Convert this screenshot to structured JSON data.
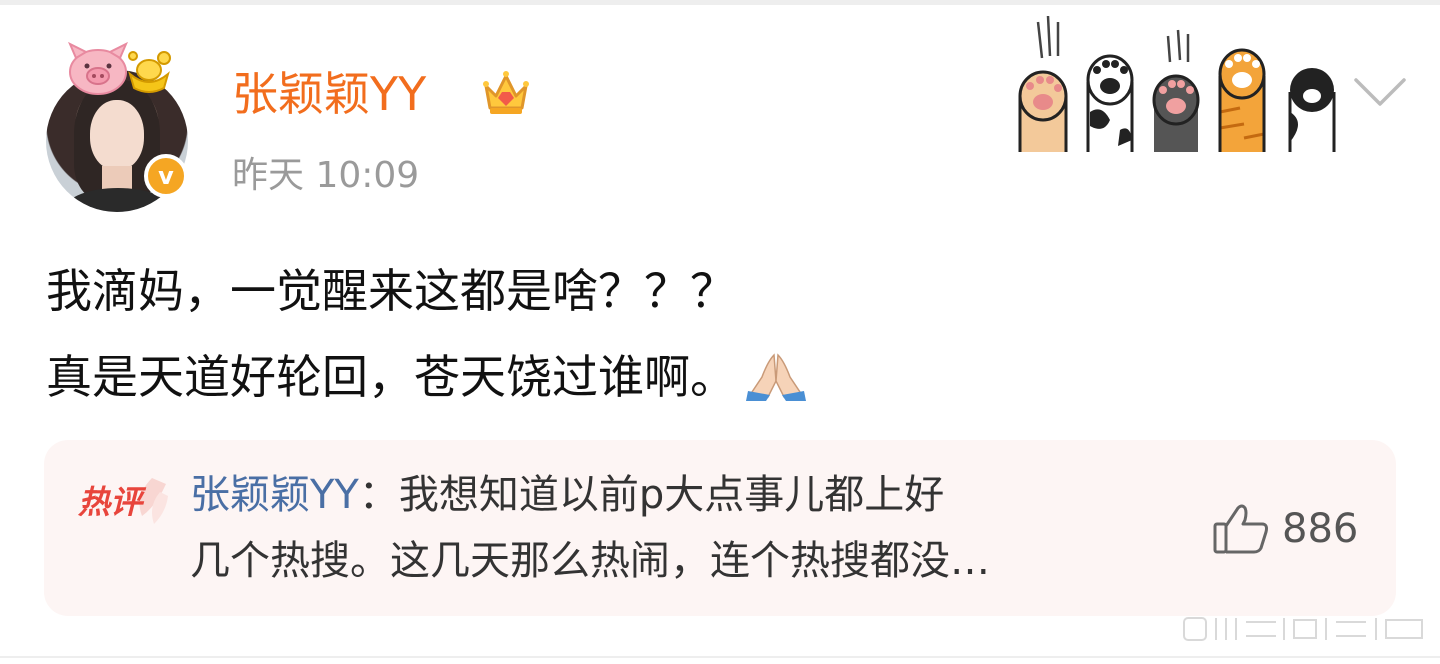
{
  "post": {
    "author": "张颖颖YY",
    "timestamp": "昨天 10:09",
    "verified_mark": "v",
    "text_lines": [
      "我滴妈，一觉醒来这都是啥？？？",
      "真是天道好轮回，苍天饶过谁啊。"
    ],
    "trailing_emoji": "pray-icon"
  },
  "hot_comment": {
    "badge_label": "热评",
    "author": "张颖颖YY",
    "separator": "：",
    "text_line1": "我想知道以前p大点事儿都上好",
    "text_line2": "几个热搜。这几天那么热闹，连个热搜都没…",
    "like_count": "886"
  },
  "icons": {
    "decoration": [
      "pig-icon",
      "gold-ingot-icon",
      "crown-icon",
      "paws-decoration",
      "chevron-down-icon",
      "thumbs-up-icon"
    ]
  },
  "colors": {
    "username": "#f26d1d",
    "timestamp": "#9a9a9a",
    "comment_author": "#4a6fa5",
    "hot_badge": "#e8453c",
    "card_bg": "#fdf5f4",
    "verified": "#f5a623"
  }
}
